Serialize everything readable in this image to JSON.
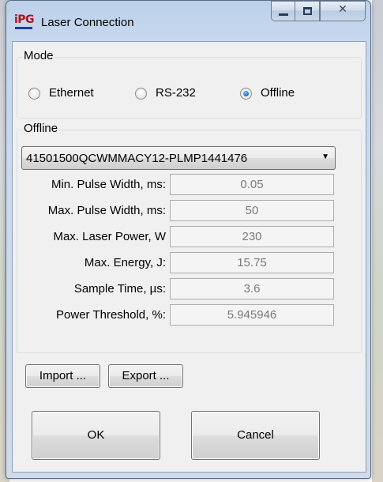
{
  "window": {
    "title": "Laser Connection",
    "app_icon_text": "iPG"
  },
  "mode": {
    "title": "Mode",
    "options": [
      {
        "label": "Ethernet",
        "selected": false
      },
      {
        "label": "RS-232",
        "selected": false
      },
      {
        "label": "Offline",
        "selected": true
      }
    ]
  },
  "offline": {
    "title": "Offline",
    "selected_laser": "41501500QCWMMACY12-PLMP1441476",
    "params": [
      {
        "label": "Min. Pulse Width, ms:",
        "value": "0.05"
      },
      {
        "label": "Max. Pulse Width, ms:",
        "value": "50"
      },
      {
        "label": "Max. Laser Power, W",
        "value": "230"
      },
      {
        "label": "Max. Energy, J:",
        "value": "15.75"
      },
      {
        "label": "Sample Time, µs:",
        "value": "3.6"
      },
      {
        "label": "Power Threshold, %:",
        "value": "5.945946"
      }
    ]
  },
  "buttons": {
    "import": "Import ...",
    "export": "Export ...",
    "ok": "OK",
    "cancel": "Cancel"
  },
  "colors": {
    "frame": "#c6d8ee",
    "client": "#f0f0f0",
    "radio_selected": "#1e6fd0",
    "disabled_text": "#7a7a7a"
  }
}
